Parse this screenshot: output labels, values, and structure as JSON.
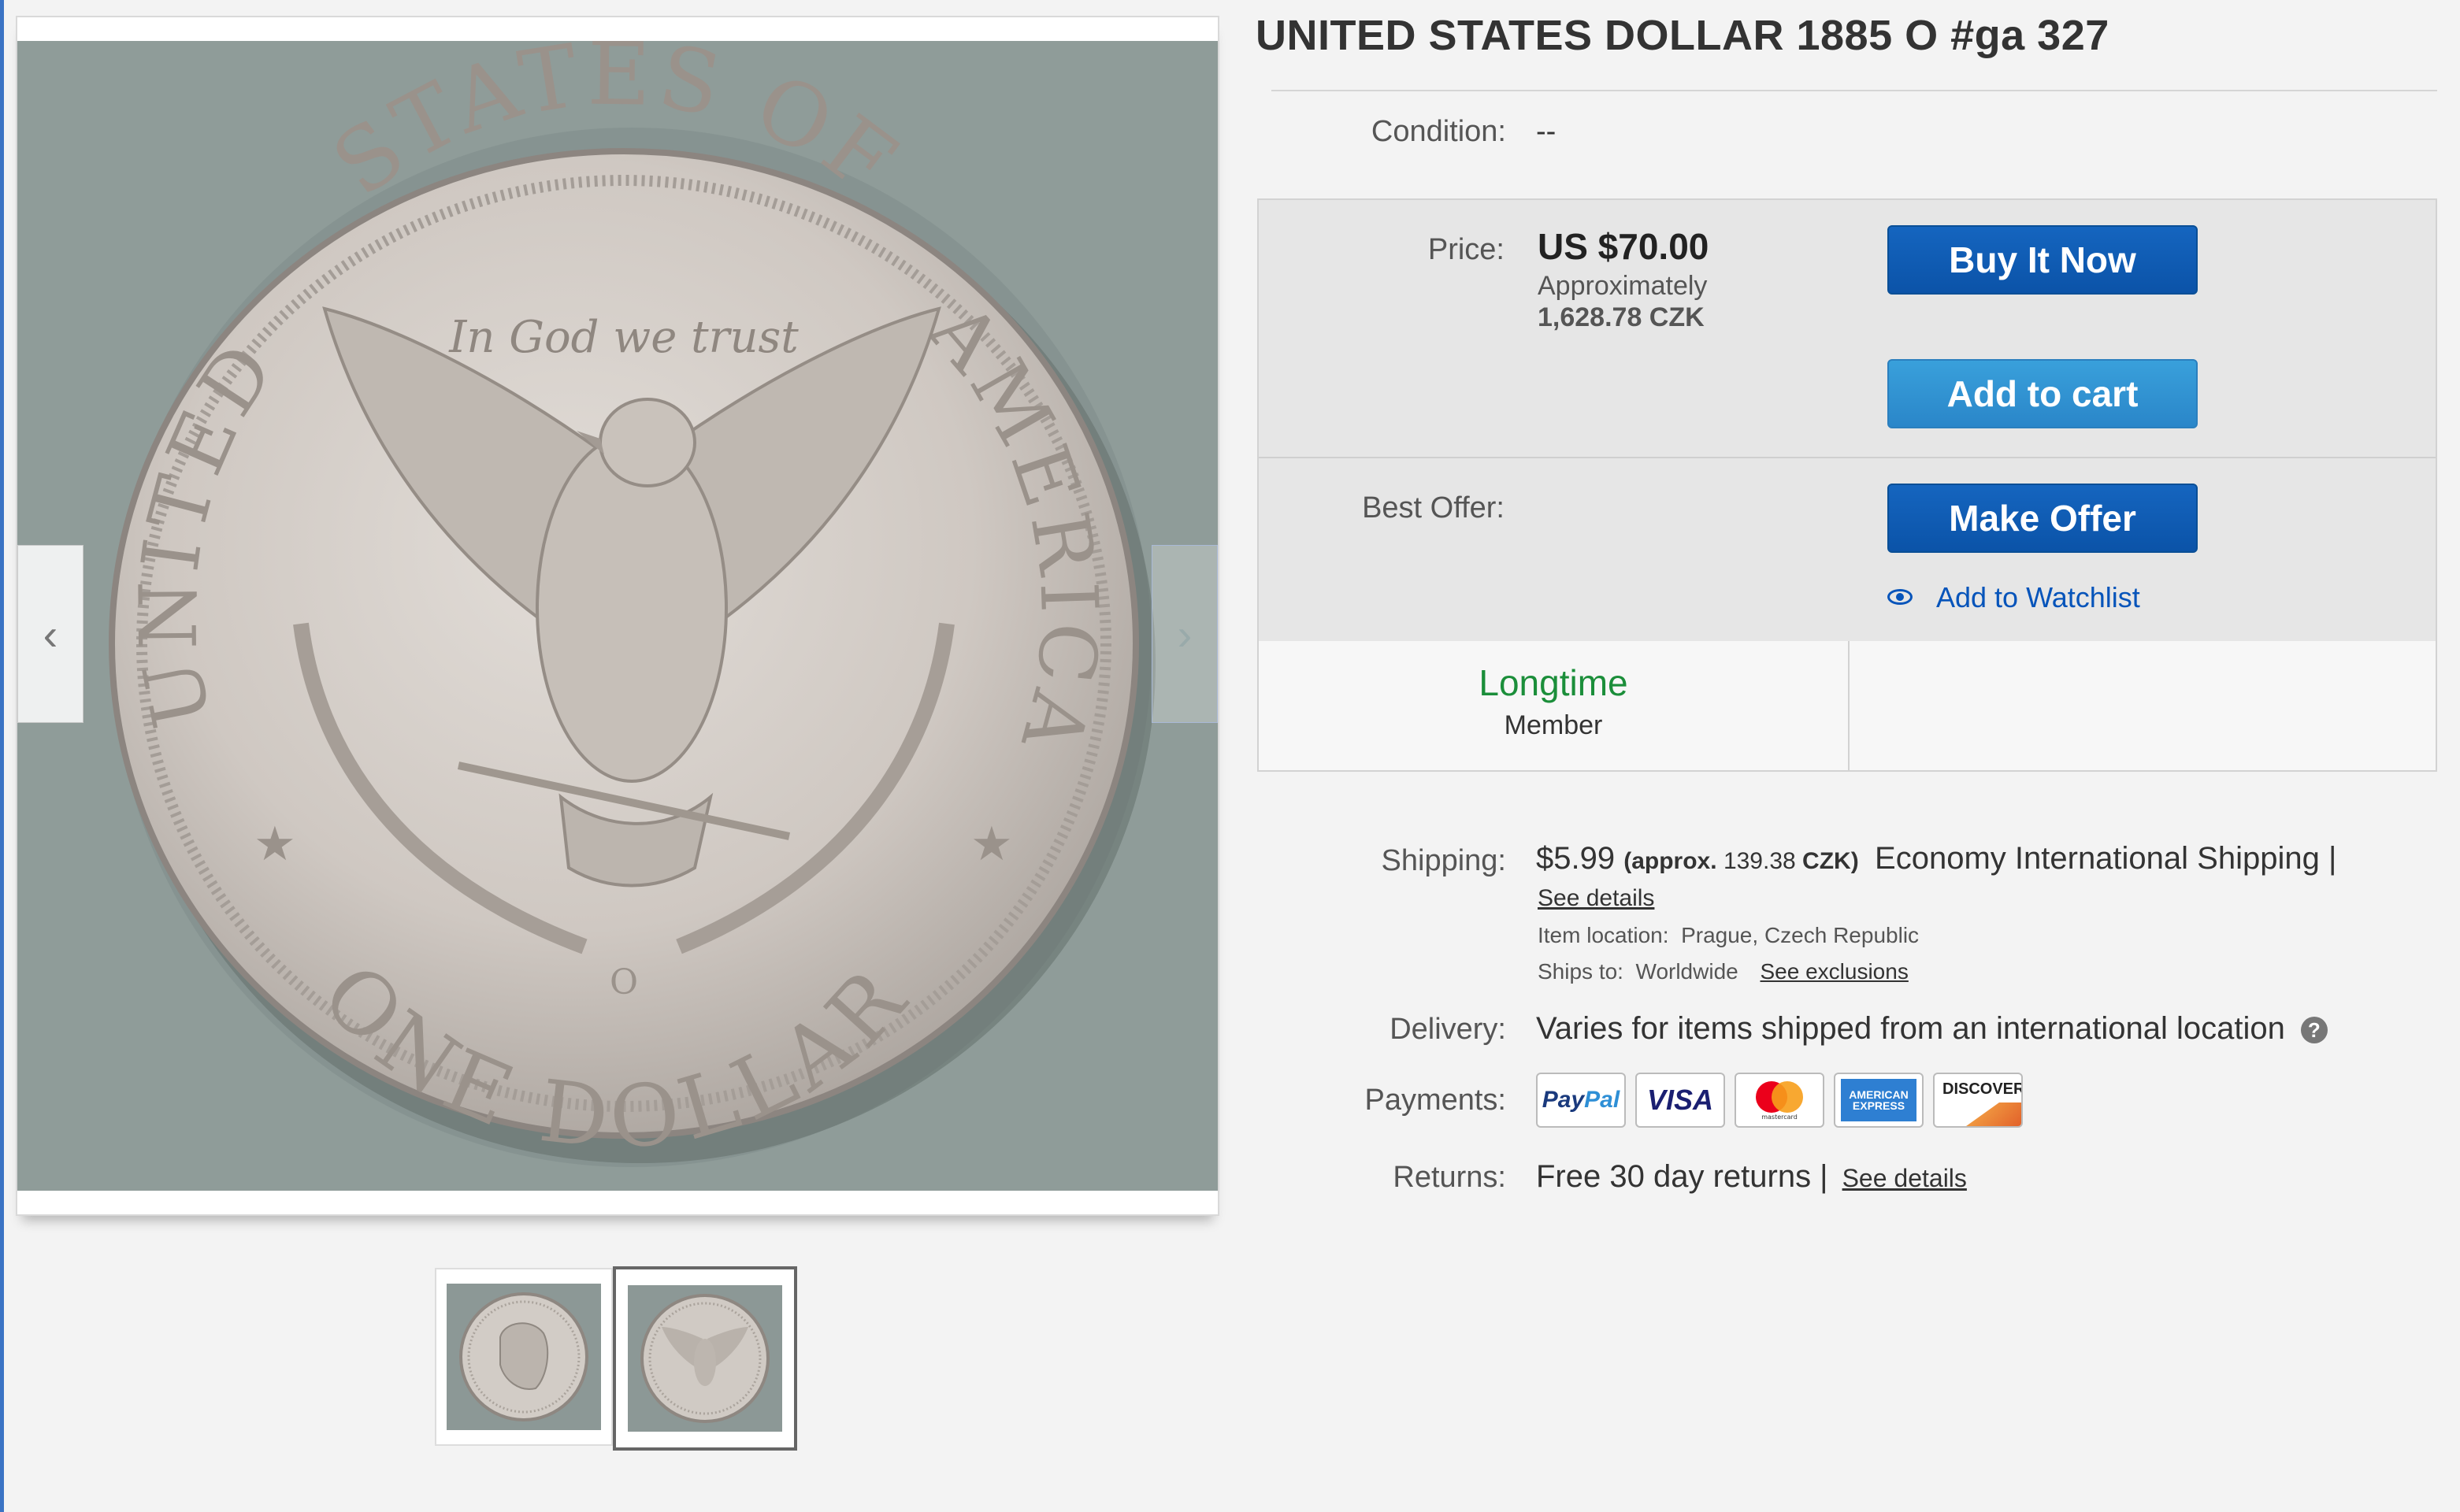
{
  "listing": {
    "title": "UNITED STATES DOLLAR 1885 O #ga 327",
    "condition_label": "Condition:",
    "condition_value": "--"
  },
  "purchase": {
    "price_label": "Price:",
    "price": "US $70.00",
    "approx_label": "Approximately",
    "approx_value": "1,628.78 CZK",
    "buy_now": "Buy It Now",
    "add_to_cart": "Add to cart",
    "best_offer_label": "Best Offer:",
    "make_offer": "Make Offer",
    "watchlist": "Add to Watchlist"
  },
  "seller": {
    "badge_main": "Longtime",
    "badge_sub": "Member"
  },
  "shipping": {
    "label": "Shipping:",
    "cost": "$5.99",
    "approx_prefix": "(approx.",
    "approx_value": "139.38",
    "approx_suffix": "CZK)",
    "method": "Economy International Shipping |",
    "details_link": "See details",
    "item_location_label": "Item location:",
    "item_location": "Prague, Czech Republic",
    "ships_to_label": "Ships to:",
    "ships_to": "Worldwide",
    "exclusions_link": "See exclusions"
  },
  "delivery": {
    "label": "Delivery:",
    "value": "Varies for items shipped from an international location",
    "help": "?"
  },
  "payments": {
    "label": "Payments:",
    "methods": [
      "PayPal",
      "VISA",
      "mastercard",
      "AMERICAN EXPRESS",
      "DISCOVER"
    ],
    "paypal_pay": "Pay",
    "paypal_pal": "Pal"
  },
  "returns": {
    "label": "Returns:",
    "value": "Free 30 day returns |",
    "details_link": "See details"
  },
  "gallery": {
    "prev": "‹",
    "next": "›",
    "coin_top_text": "STATES OF",
    "coin_left_text": "UNITED",
    "coin_right_text": "AMERICA",
    "coin_motto": "In God we trust",
    "coin_bottom_text": "ONE DOLLAR",
    "coin_mint": "O",
    "thumbnail_count": 2,
    "selected_thumbnail": 2
  },
  "colors": {
    "primary_button": "#0b53a8",
    "cart_button": "#2a86c9",
    "link": "#0654ba",
    "member_green": "#1b8e3a"
  }
}
